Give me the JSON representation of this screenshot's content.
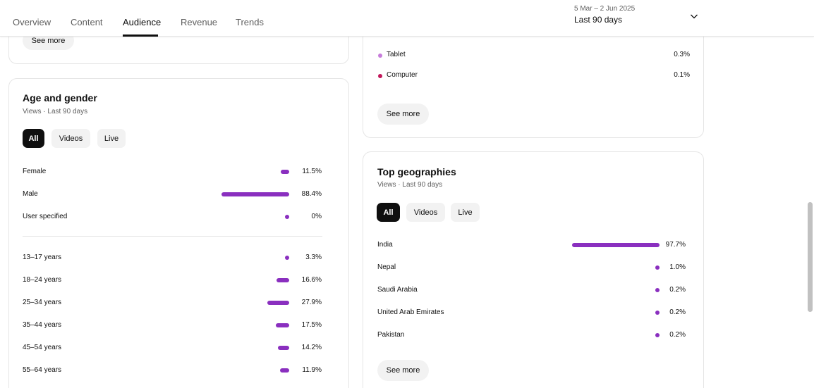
{
  "tabs": [
    {
      "label": "Overview"
    },
    {
      "label": "Content"
    },
    {
      "label": "Audience"
    },
    {
      "label": "Revenue"
    },
    {
      "label": "Trends"
    }
  ],
  "active_tab": "Audience",
  "date_picker": {
    "range": "5 Mar – 2 Jun 2025",
    "period": "Last 90 days"
  },
  "top_left_card": {
    "see_more": "See more"
  },
  "device_card": {
    "rows": [
      {
        "label": "Tablet",
        "pct": "0.3%",
        "color": "#c77ddb"
      },
      {
        "label": "Computer",
        "pct": "0.1%",
        "color": "#c2185b"
      }
    ],
    "see_more": "See more"
  },
  "age_gender": {
    "title": "Age and gender",
    "subtitle": "Views · Last 90 days",
    "chips": [
      "All",
      "Videos",
      "Live"
    ],
    "gender": [
      {
        "label": "Female",
        "pct": "11.5%",
        "value": 11.5
      },
      {
        "label": "Male",
        "pct": "88.4%",
        "value": 88.4
      },
      {
        "label": "User specified",
        "pct": "0%",
        "value": 0
      }
    ],
    "ages": [
      {
        "label": "13–17 years",
        "pct": "3.3%",
        "value": 3.3
      },
      {
        "label": "18–24 years",
        "pct": "16.6%",
        "value": 16.6
      },
      {
        "label": "25–34 years",
        "pct": "27.9%",
        "value": 27.9
      },
      {
        "label": "35–44 years",
        "pct": "17.5%",
        "value": 17.5
      },
      {
        "label": "45–54 years",
        "pct": "14.2%",
        "value": 14.2
      },
      {
        "label": "55–64 years",
        "pct": "11.9%",
        "value": 11.9
      }
    ],
    "bar_color": "#8a2fbf"
  },
  "geographies": {
    "title": "Top geographies",
    "subtitle": "Views · Last 90 days",
    "chips": [
      "All",
      "Videos",
      "Live"
    ],
    "rows": [
      {
        "label": "India",
        "pct": "97.7%",
        "value": 97.7
      },
      {
        "label": "Nepal",
        "pct": "1.0%",
        "value": 1.0
      },
      {
        "label": "Saudi Arabia",
        "pct": "0.2%",
        "value": 0.2
      },
      {
        "label": "United Arab Emirates",
        "pct": "0.2%",
        "value": 0.2
      },
      {
        "label": "Pakistan",
        "pct": "0.2%",
        "value": 0.2
      }
    ],
    "see_more": "See more",
    "bar_color": "#8a2fbf"
  }
}
